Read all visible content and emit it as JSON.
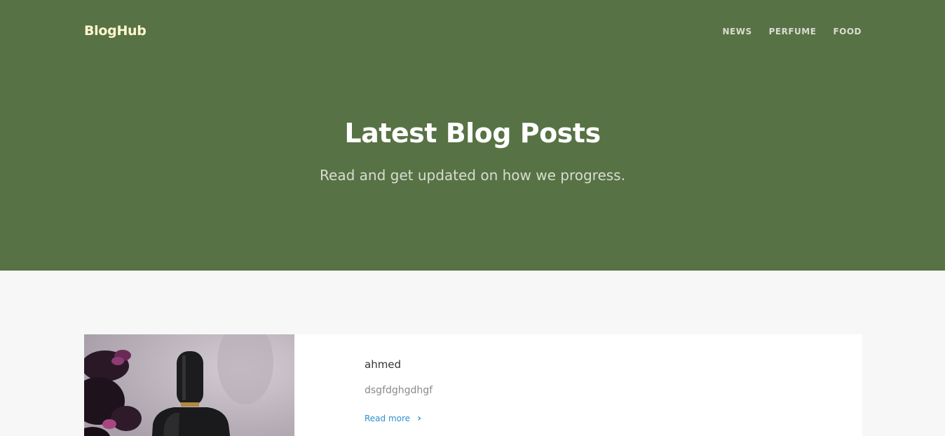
{
  "header": {
    "brand": "BlogHub",
    "nav": [
      "NEWS",
      "PERFUME",
      "FOOD"
    ]
  },
  "hero": {
    "title": "Latest Blog Posts",
    "subtitle": "Read and get updated on how we progress."
  },
  "posts": [
    {
      "title": "ahmed",
      "excerpt": "dsgfdghgdhgf",
      "read_more": "Read more",
      "image": "perfume-bottle-photo"
    }
  ],
  "colors": {
    "hero_bg": "#577244",
    "brand": "#fff6cf",
    "link": "#2e8fcf",
    "page_bg": "#f7f7f7"
  },
  "icons": {
    "read_more": "chevron-right-icon"
  }
}
